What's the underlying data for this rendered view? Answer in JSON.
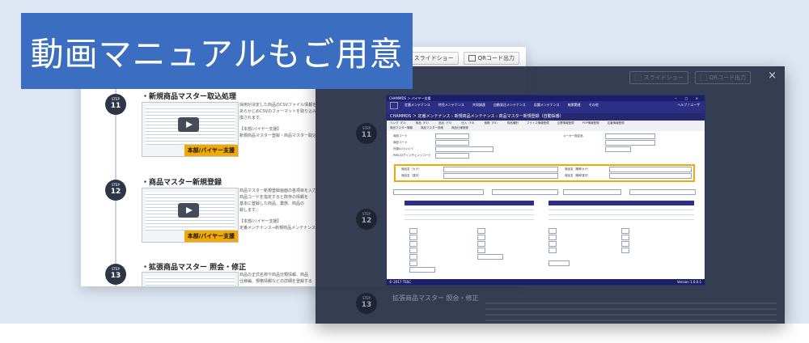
{
  "banner": {
    "headline": "動画マニュアルもご用意"
  },
  "toolbar": {
    "slideshow": "スライドショー",
    "qrcode": "QRコード出力"
  },
  "steps": [
    {
      "label": "STEP",
      "number": "11",
      "title": "・新規商品マスター取込処理",
      "badge": "本部/バイヤー支援",
      "desc": [
        "採用が決定した商品のCSVファイル情報を",
        "あらかじめCSVのフォーマットを取り込み",
        "換されます。",
        "",
        "【本部/バイヤー支援】",
        "新規商品マスター登録・商品マスター取込"
      ]
    },
    {
      "label": "STEP",
      "number": "12",
      "title": "・商品マスター新規登録",
      "badge": "本部/バイヤー支援",
      "desc": [
        "商品マスター新規登録画面の各項目を入力",
        "商品コードを指定すると既存の情報を",
        "基本に登録した商品、業態、商品の",
        "録します。",
        "",
        "【本部/バイヤー支援】",
        "定番メンテナンス→新規商品メンテナンス→"
      ]
    },
    {
      "label": "STEP",
      "number": "13",
      "title": "・拡張商品マスター 照会・修正",
      "badge": "",
      "desc": [
        "商品の正式名称や商品分類情報、商品",
        "仕様編、規格情報などの詳細を登録する"
      ]
    }
  ],
  "overlay": {
    "close": "×",
    "ghost_step_title": "拡張商品マスター 照会・修正",
    "app": {
      "title": "CHAMMDS ＞ バイヤー支援",
      "window_controls": "－ □ ×",
      "menu": [
        "定番メンテナンス",
        "特売メンテナンス",
        "共同調達",
        "自動発注メンテナンス",
        "店舗メンテナンス",
        "帳票関連",
        "その他"
      ],
      "help": "ヘルプ / ユーザ",
      "screen_title": "CHAMMDS ＞ 定番メンテナンス › 新規商品メンテナンス › 商品マスター新規登録（自動採番）",
      "tabs": [
        "ベンダ（F1）",
        "商品（F2）",
        "品目（F3）",
        "仕入（F4）",
        "価格（F5）",
        "商品種別",
        "プライス情報登録",
        "企業情報登録",
        "POP情報登録",
        "定番情報登録"
      ],
      "tabs2": [
        "商品マスター情報",
        "商品マスター詳細",
        "商品仕様登録"
      ],
      "fields": [
        "商品コード",
        "商品コード",
        "外部ﾎｽﾄﾌｫﾝﾄｺｰﾄﾞ",
        "PMS/ログインチェンジコード",
        "メーカー指定品",
        "商品名（カナ）",
        "商品名（漢字）",
        "商品名（略称カナ）",
        "商品名（略称漢字）"
      ],
      "status_left": "© 2017 TSSC",
      "status_right": "Version 1.0.0.1"
    }
  }
}
